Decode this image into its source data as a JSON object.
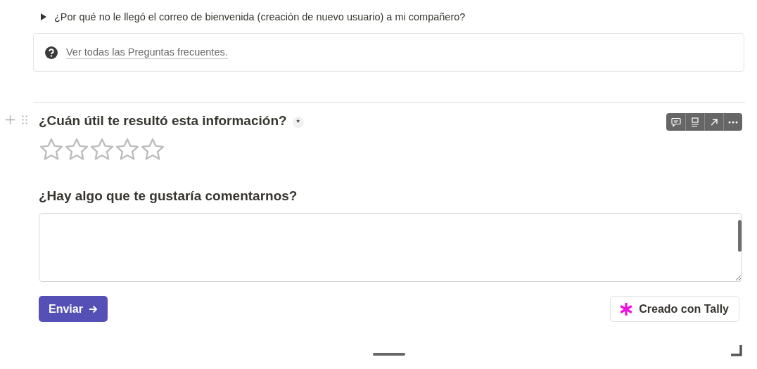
{
  "toggle_item": {
    "label": "¿Por qué no le llegó el correo de bienvenida (creación de nuevo usuario) a mi compañero?",
    "expanded": false
  },
  "callout": {
    "link": "Ver todas las Preguntas frecuentes."
  },
  "form": {
    "rating_question": {
      "label": "¿Cuán útil te resultó esta información?",
      "required_mark": "*",
      "stars": 0
    },
    "comment_question": {
      "label": "¿Hay algo que te gustaría comentarnos?"
    },
    "submit": "Enviar",
    "badge": "Creado con Tally"
  }
}
